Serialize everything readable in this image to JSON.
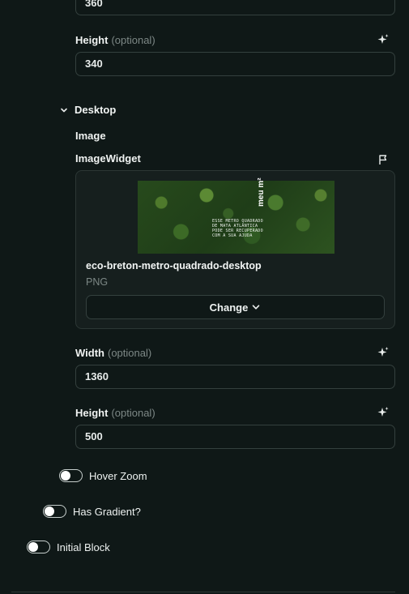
{
  "mobile": {
    "width_value": "360",
    "height_label": "Height",
    "height_optional": "(optional)",
    "height_value": "340"
  },
  "desktop": {
    "section_title": "Desktop",
    "image_label": "Image",
    "widget_label": "ImageWidget",
    "file": {
      "name": "eco-breton-metro-quadrado-desktop",
      "type": "PNG",
      "thumb_logo": "meu m²",
      "thumb_text": "ESSE METRO QUADRADO\nDE MATA ATLÂNTICA\nPODE SER RECUPERADO\nCOM A SUA AJUDA",
      "change_label": "Change"
    },
    "width_label": "Width",
    "width_optional": "(optional)",
    "width_value": "1360",
    "height_label": "Height",
    "height_optional": "(optional)",
    "height_value": "500"
  },
  "toggles": {
    "hover_zoom": "Hover Zoom",
    "has_gradient": "Has Gradient?",
    "initial_block": "Initial Block"
  },
  "colors": {
    "background": "#0f1817",
    "card": "#161f1e",
    "border": "#34403e",
    "muted_text": "#7d8886"
  }
}
